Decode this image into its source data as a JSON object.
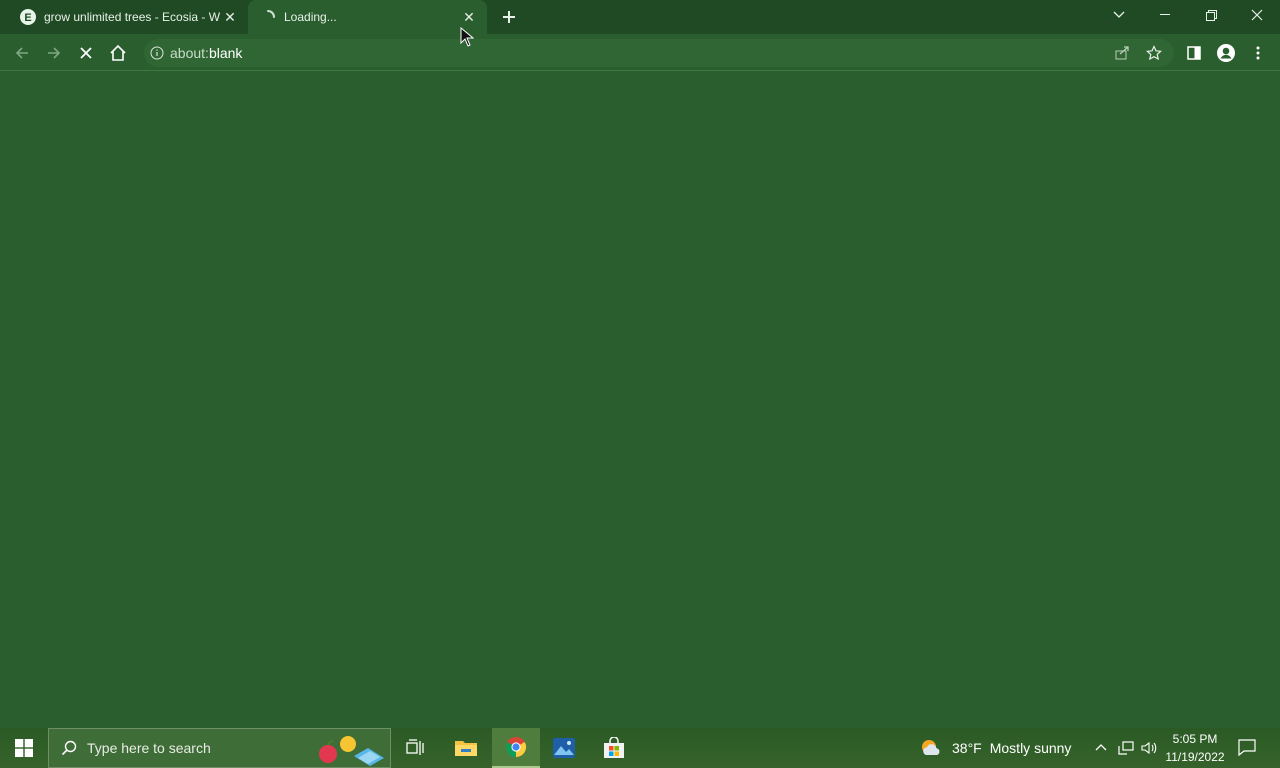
{
  "browser": {
    "tabs": [
      {
        "title": "grow unlimited trees - Ecosia - W",
        "favicon": "ecosia-icon",
        "active": false
      },
      {
        "title": "Loading...",
        "favicon": "loading-spinner-icon",
        "active": true
      }
    ],
    "address_bar": {
      "url_prefix": "about:",
      "url_host": "blank"
    },
    "colors": {
      "frame": "#1f4a24",
      "toolbar": "#2a5e2f",
      "content": "#2a5e2f"
    }
  },
  "taskbar": {
    "search_placeholder": "Type here to search",
    "weather": {
      "temp": "38°F",
      "condition": "Mostly sunny"
    },
    "clock": {
      "time": "5:05 PM",
      "date": "11/19/2022"
    }
  }
}
